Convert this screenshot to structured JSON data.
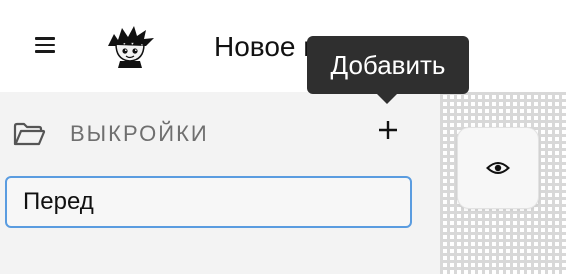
{
  "header": {
    "menu_icon": "hamburger-menu-icon",
    "logo_icon": "cartoon-character-logo",
    "document_title": "Новое н"
  },
  "sidebar": {
    "section_icon": "folder-icon",
    "section_title": "ВЫКРОЙКИ",
    "add_icon": "plus-icon",
    "pattern_name_input_value": "Перед"
  },
  "canvas": {
    "preview_icon": "eye-icon"
  },
  "tooltip": {
    "text": "Добавить"
  },
  "colors": {
    "input_focus_border": "#5a9ce0",
    "sidebar_bg": "#f3f3f3",
    "tooltip_bg": "#2f2f2f"
  }
}
